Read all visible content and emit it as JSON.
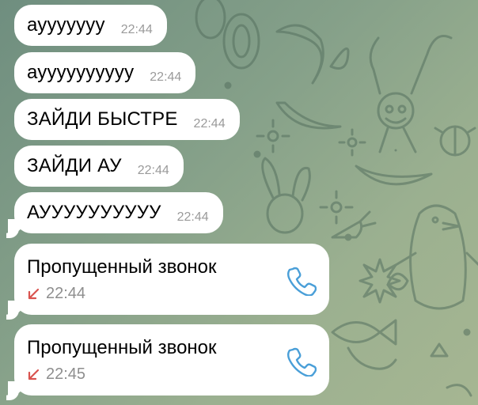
{
  "colors": {
    "accent": "#4a9fd8",
    "missed": "#d9534f",
    "bubble": "#ffffff"
  },
  "messages": [
    {
      "text": "аууууууу",
      "time": "22:44"
    },
    {
      "text": "ауууууууууу",
      "time": "22:44"
    },
    {
      "text": "ЗАЙДИ БЫСТРЕ",
      "time": "22:44"
    },
    {
      "text": "ЗАЙДИ АУ",
      "time": "22:44"
    },
    {
      "text": "АУУУУУУУУУУ",
      "time": "22:44"
    }
  ],
  "calls": [
    {
      "title": "Пропущенный звонок",
      "time": "22:44",
      "status_icon": "missed-call-arrow-icon",
      "action_icon": "phone-icon"
    },
    {
      "title": "Пропущенный звонок",
      "time": "22:45",
      "status_icon": "missed-call-arrow-icon",
      "action_icon": "phone-icon"
    }
  ]
}
